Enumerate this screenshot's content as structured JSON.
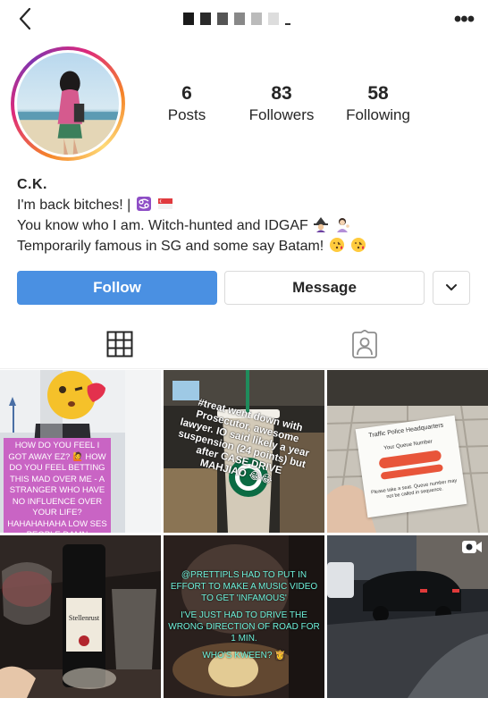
{
  "header": {
    "back_icon": "chevron-left-icon",
    "username_obscured": true,
    "more_icon": "more-dots-icon"
  },
  "profile": {
    "stats": {
      "posts_count": "6",
      "posts_label": "Posts",
      "followers_count": "83",
      "followers_label": "Followers",
      "following_count": "58",
      "following_label": "Following"
    },
    "bio": {
      "name": "C.K.",
      "line1": "I'm back bitches! |",
      "line2": "You know who I am. Witch-hunted and IDGAF",
      "line3": "Temporarily famous in SG and some say Batam!"
    }
  },
  "actions": {
    "follow_label": "Follow",
    "message_label": "Message",
    "dropdown_icon": "chevron-down-icon"
  },
  "colors": {
    "follow_blue": "#4a90e2",
    "overlay_pink": "#c964c4",
    "overlay_teal": "#6ff3dc"
  },
  "tabs": {
    "grid_icon": "grid-icon",
    "tagged_icon": "tagged-person-icon"
  },
  "posts": [
    {
      "overlay": "How do you feel I got away EZ? 🙋 How do you feel betting this mad over me - a stranger who have no influence over your life? Hahahahaha Low SES people damn"
    },
    {
      "overlay": "#treat went down with Prosecutor, awesome lawyer. IO said likely a year suspension (24 points) but after CASE DRIVE MAHJIAO 😂😂"
    },
    {
      "ticket_title": "Traffic Police Headquarters",
      "ticket_sub": "Your Queue Number",
      "ticket_note": "Please take a seat. Queue number may not be called in sequence."
    },
    {
      "bottle_label": "Stellenrust"
    },
    {
      "overlay_a": "@PRETTIPLS HAD TO PUT IN EFFORT TO MAKE A MUSIC VIDEO TO GET 'INFAMOUS'",
      "overlay_b": "I'VE JUST HAD TO DRIVE THE WRONG DIRECTION OF ROAD FOR 1 MIN.",
      "overlay_c": "WHO'S KWEEN? 👸"
    },
    {
      "media_type": "video"
    }
  ]
}
